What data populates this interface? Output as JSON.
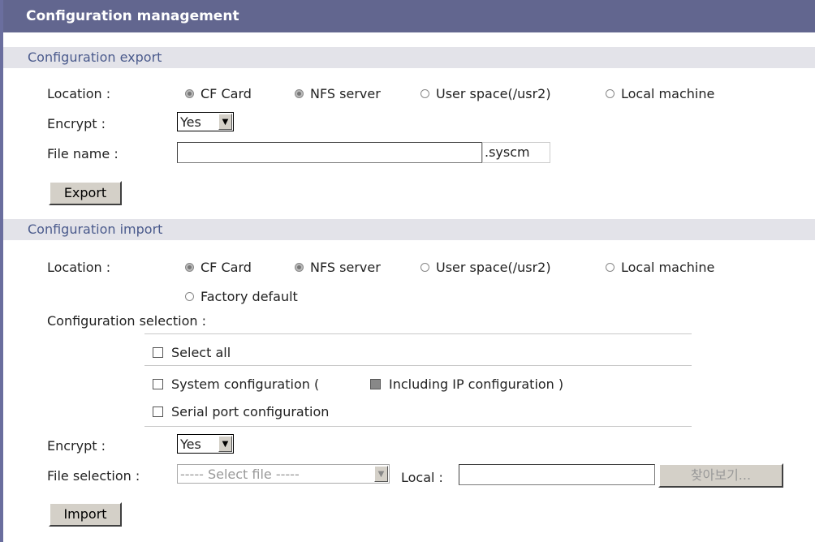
{
  "title": "Configuration management",
  "export": {
    "section_title": "Configuration export",
    "location_label": "Location :",
    "location_options": [
      "CF Card",
      "NFS server",
      "User space(/usr2)",
      "Local machine"
    ],
    "encrypt_label": "Encrypt :",
    "encrypt_value": "Yes",
    "filename_label": "File name :",
    "filename_value": "",
    "filename_suffix": ".syscm",
    "export_button": "Export"
  },
  "import": {
    "section_title": "Configuration import",
    "location_label": "Location :",
    "location_options": [
      "CF Card",
      "NFS server",
      "User space(/usr2)",
      "Local machine",
      "Factory default"
    ],
    "config_selection_label": "Configuration selection :",
    "select_all": "Select all",
    "system_config": "System configuration (",
    "including_ip": "Including IP configuration )",
    "serial_port_config": "Serial port configuration",
    "encrypt_label": "Encrypt :",
    "encrypt_value": "Yes",
    "file_selection_label": "File selection :",
    "file_select_value": "----- Select file -----",
    "local_label": "Local :",
    "local_value": "",
    "browse_button": "찾아보기...",
    "import_button": "Import"
  }
}
